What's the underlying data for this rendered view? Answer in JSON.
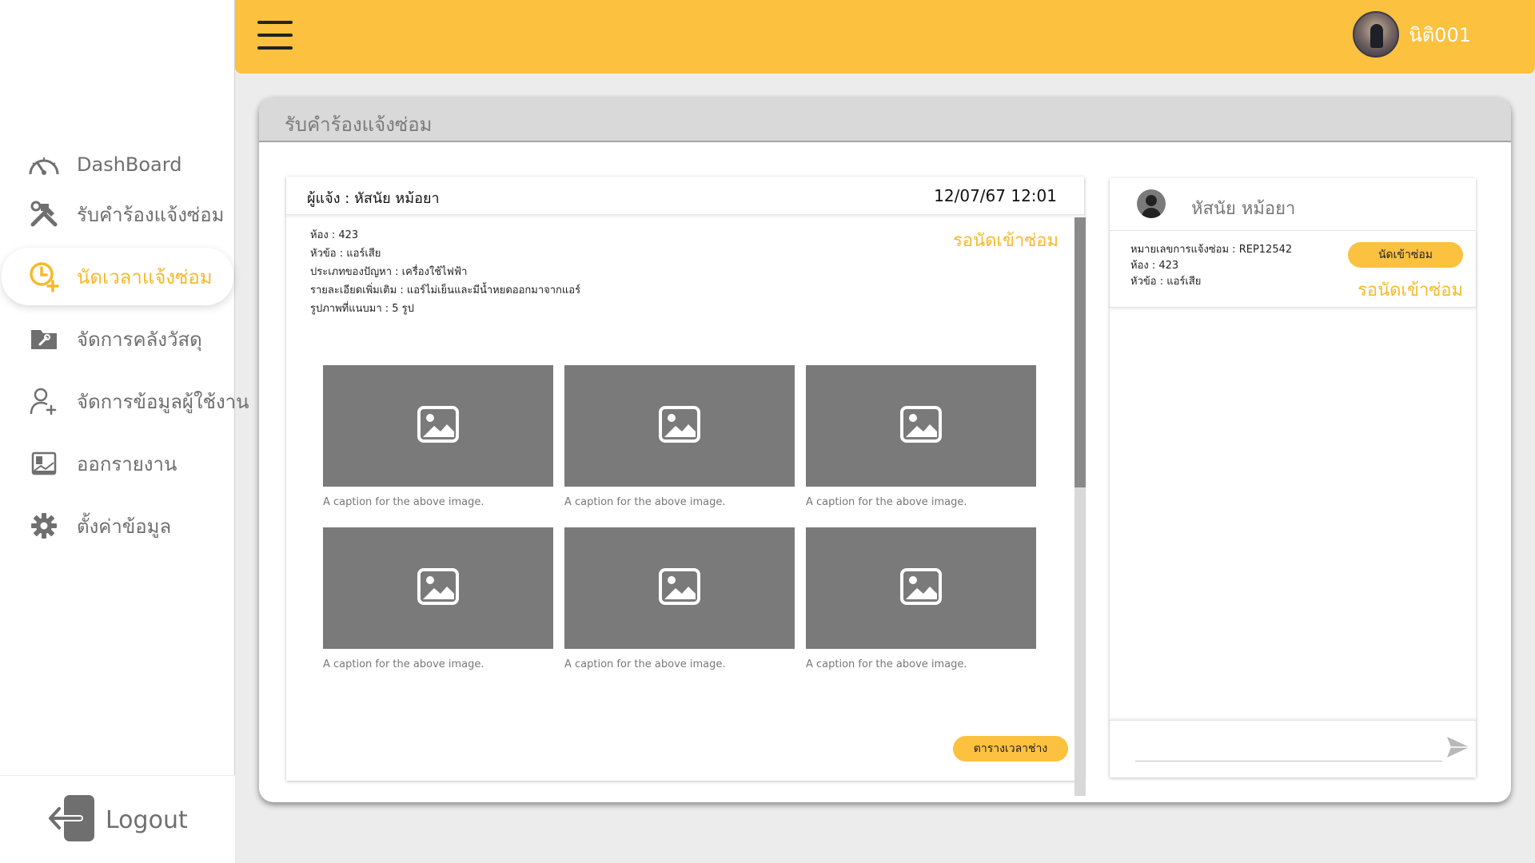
{
  "sidebar": {
    "items": [
      {
        "label": "DashBoard",
        "icon": "dashboard-gauge-icon"
      },
      {
        "label": "รับคำร้องแจ้งซ่อม",
        "icon": "tools-icon"
      },
      {
        "label": "นัดเวลาแจ้งซ่อม",
        "icon": "clock-plus-icon"
      },
      {
        "label": "จัดการคลังวัสดุ",
        "icon": "folder-wrench-icon"
      },
      {
        "label": "จัดการข้อมูลผู้ใช้งาน",
        "icon": "user-plus-icon"
      },
      {
        "label": "ออกรายงาน",
        "icon": "report-icon"
      },
      {
        "label": "ตั้งค่าข้อมูล",
        "icon": "gear-icon"
      }
    ],
    "logout_label": "Logout"
  },
  "topbar": {
    "username": "นิติ001"
  },
  "panel": {
    "title": "รับคำร้องแจ้งซ่อม"
  },
  "report": {
    "reporter": "ผู้แจ้ง : หัสนัย หม้อยา",
    "datetime": "12/07/67 12:01",
    "status": "รอนัดเข้าซ่อม",
    "details": [
      "ห้อง : 423",
      "หัวข้อ : แอร์เสีย",
      "ประเภทของปัญหา : เครื่องใช้ไฟฟ้า",
      "รายละเอียดเพิ่มเติม : แอร์ไม่เย็นและมีน้ำหยดออกมาจากแอร์",
      "รูปภาพที่แนบมา : 5 รูป"
    ],
    "images": [
      {
        "caption": "A caption for the above image."
      },
      {
        "caption": "A caption for the above image."
      },
      {
        "caption": "A caption for the above image."
      },
      {
        "caption": "A caption for the above image."
      },
      {
        "caption": "A caption for the above image."
      },
      {
        "caption": "A caption for the above image."
      }
    ],
    "schedule_button": "ตารางเวลาช่าง"
  },
  "chat": {
    "name": "หัสนัย หม้อยา",
    "ticket": {
      "number": "หมายเลขการแจ้งซ่อม : REP12542",
      "room": "ห้อง : 423",
      "topic": "หัวข้อ : แอร์เสีย",
      "button": "นัดเข้าซ่อม",
      "status": "รอนัดเข้าซ่อม"
    },
    "input_placeholder": ""
  },
  "colors": {
    "accent": "#fbc13f",
    "status_text": "#f6b92b",
    "image_placeholder": "#7a7a7a"
  }
}
